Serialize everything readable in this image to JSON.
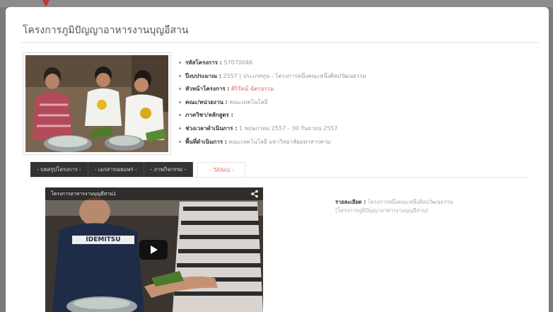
{
  "page": {
    "title": "โครงการภูมิปัญญาอาหารงานบุญอีสาน"
  },
  "info": [
    {
      "key": "รหัสโครงการ :",
      "value": "57070046"
    },
    {
      "key": "ปีงบประมาณ :",
      "value": "2557 | ประเภททุน : โครงการหนึ่งคณะหนึ่งศิลปวัฒนธรรม"
    },
    {
      "key": "หัวหน้าโครงการ :",
      "value": "ศิริรัตน์ ฉัตรธรรม",
      "highlight": true
    },
    {
      "key": "คณะ/หน่วยงาน :",
      "value": "คณะเทคโนโลยี"
    },
    {
      "key": "ภาควิชา/หลักสูตร :",
      "value": ""
    },
    {
      "key": "ช่วงเวลาดำเนินการ :",
      "value": "1 พฤษภาคม 2557 - 30 กันยายน 2557"
    },
    {
      "key": "พื้นที่ดำเนินการ :",
      "value": "คณะเทคโนโลยี มหาวิทยาลัยมหาสารคาม"
    }
  ],
  "tabs": [
    "- บทสรุปโครงการ -",
    "- เอกสารเผยแพร่ -",
    "- ภาพกิจกรรม -",
    "- วีดิทัศน์ -"
  ],
  "video": {
    "title": "โครงการอาหารงานบุญอีสาน1",
    "shirt_text": "IDEMITSU"
  },
  "detail": {
    "key": "รายละเอียด :",
    "value": "โครงการหนึ่งคณะหนึ่งศิลปวัฒนธรรม (โครงการภูมิปัญญาอาหารงานบุญอีสาน)"
  },
  "colors": {
    "accent": "#e67e66",
    "tab_bg": "#333333",
    "highlight": "#e06666"
  }
}
